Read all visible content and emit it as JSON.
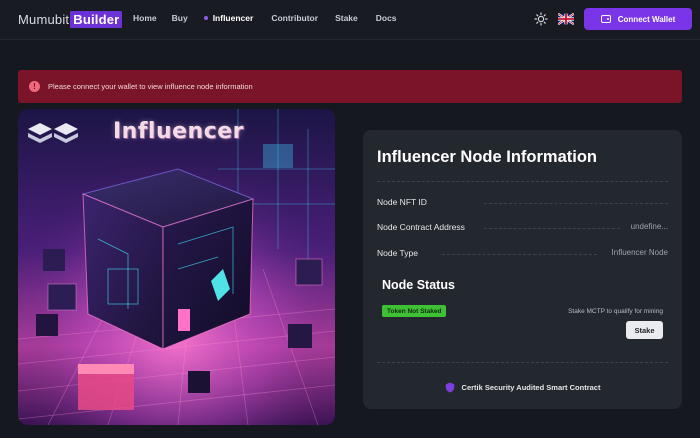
{
  "header": {
    "logo_part1": "Mumubit",
    "logo_part2": "Builder",
    "nav": [
      {
        "label": "Home",
        "active": false
      },
      {
        "label": "Buy",
        "active": false
      },
      {
        "label": "Influencer",
        "active": true
      },
      {
        "label": "Contributor",
        "active": false
      },
      {
        "label": "Stake",
        "active": false
      },
      {
        "label": "Docs",
        "active": false
      }
    ],
    "theme_icon": "sun-icon",
    "language_icon": "uk-flag-icon",
    "connect_label": "Connect Wallet",
    "connect_icon": "wallet-icon"
  },
  "alert": {
    "icon": "exclamation-icon",
    "message": "Please connect your wallet to view influence node information"
  },
  "hero": {
    "title": "Influencer"
  },
  "panel": {
    "title": "Influencer Node Information",
    "rows": [
      {
        "label": "Node NFT ID",
        "value": ""
      },
      {
        "label": "Node Contract Address",
        "value": "undefine..."
      },
      {
        "label": "Node Type",
        "value": "Influencer Node"
      }
    ],
    "status_title": "Node Status",
    "status_badge": "Token Not Staked",
    "stake_hint": "Stake MCTP to qualify for mining",
    "stake_label": "Stake",
    "certik_label": "Certik Security Audited Smart Contract",
    "certik_icon": "shield-icon"
  },
  "colors": {
    "background": "#15181e",
    "accent": "#7b35e8",
    "alert": "#7a1428",
    "badge": "#3fc136",
    "panel": "#23272e"
  }
}
